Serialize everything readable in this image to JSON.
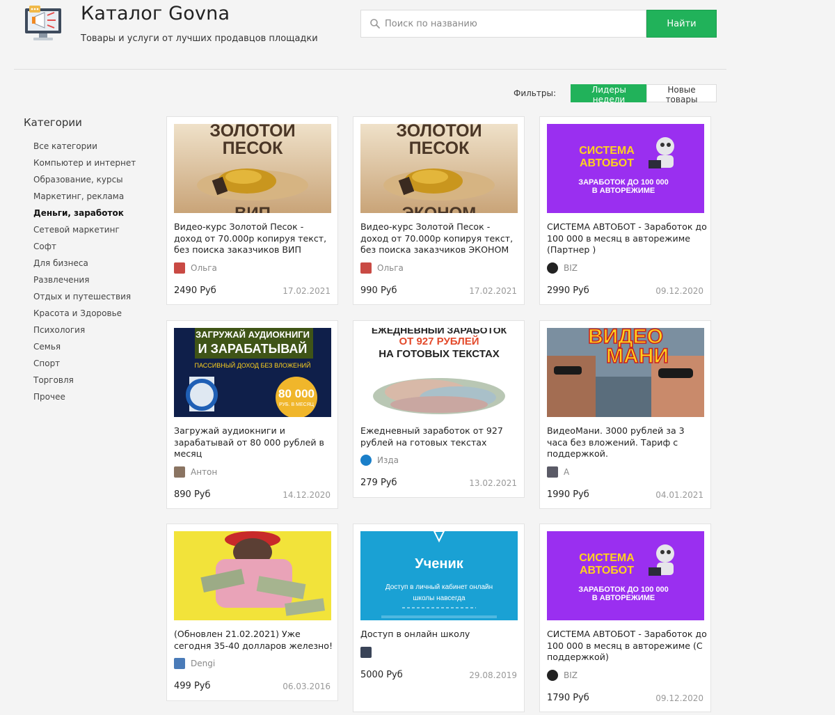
{
  "header": {
    "title": "Каталог Govna",
    "subtitle": "Товары и услуги от лучших продавцов площадки",
    "search_placeholder": "Поиск по названию",
    "search_button": "Найти"
  },
  "filters": {
    "label": "Фильтры:",
    "options": [
      "Лидеры недели",
      "Новые товары"
    ],
    "active": "Лидеры недели"
  },
  "sidebar": {
    "title": "Категории",
    "items": [
      "Все категории",
      "Компьютер и интернет",
      "Образование, курсы",
      "Маркетинг, реклама",
      "Деньги, заработок",
      "Сетевой маркетинг",
      "Софт",
      "Для бизнеса",
      "Развлечения",
      "Отдых и путешествия",
      "Красота и Здоровье",
      "Психология",
      "Семья",
      "Спорт",
      "Торговля",
      "Прочее"
    ],
    "active_index": 4
  },
  "colors": {
    "accent": "#21b25a"
  },
  "products": [
    {
      "image_text": [
        "ЗОЛОТОЙ",
        "ПЕСОК",
        "ВИП"
      ],
      "title": "Видео-курс Золотой Песок - доход от 70.000р копируя текст, без поиска заказчиков ВИП",
      "seller": "Ольга",
      "price": "2490 Руб",
      "date": "17.02.2021"
    },
    {
      "image_text": [
        "ЗОЛОТОЙ",
        "ПЕСОК",
        "ЭКОНОМ"
      ],
      "title": "Видео-курс Золотой Песок - доход от 70.000р копируя текст, без поиска заказчиков ЭКОНОМ",
      "seller": "Ольга",
      "price": "990 Руб",
      "date": "17.02.2021"
    },
    {
      "image_text": [
        "СИСТЕМА",
        "АВТОБОТ",
        "ЗАРАБОТОК ДО 100 000",
        "В АВТОРЕЖИМЕ"
      ],
      "title": "СИСТЕМА АВТОБОТ - Заработок до 100 000 в месяц в авторежиме (Партнер )",
      "seller": "BIZ",
      "price": "2990 Руб",
      "date": "09.12.2020"
    },
    {
      "image_text": [
        "ЗАГРУЖАЙ АУДИОКНИГИ",
        "И ЗАРАБАТЫВАЙ",
        "ПАССИВНЫЙ ДОХОД БЕЗ ВЛОЖЕНИЙ",
        "80 000",
        "РУБ. В МЕСЯЦ"
      ],
      "title": "Загружай аудиокниги и зарабатывай от 80 000 рублей в месяц",
      "seller": "Антон",
      "price": "890 Руб",
      "date": "14.12.2020"
    },
    {
      "image_text": [
        "ЕЖЕДНЕВНЫЙ ЗАРАБОТОК",
        "ОТ 927 РУБЛЕЙ",
        "НА ГОТОВЫХ ТЕКСТАХ"
      ],
      "title": "Ежедневный заработок от 927 рублей на готовых текстах",
      "seller": "Изда",
      "price": "279 Руб",
      "date": "13.02.2021"
    },
    {
      "image_text": [
        "ВИДЕО",
        "МАНИ"
      ],
      "title": "ВидеоМани. 3000 рублей за 3 часа без вложений. Тариф с поддержкой.",
      "seller": "A",
      "price": "1990 Руб",
      "date": "04.01.2021"
    },
    {
      "image_text": [],
      "title": "(Обновлен 21.02.2021) Уже сегодня 35-40 долларов железно!",
      "seller": "Dengi",
      "price": "499 Руб",
      "date": "06.03.2016"
    },
    {
      "image_text": [
        "Ученик",
        "Доступ в личный кабинет онлайн",
        "школы навсегда"
      ],
      "title": "Доступ в онлайн школу",
      "seller": "",
      "price": "5000 Руб",
      "date": "29.08.2019"
    },
    {
      "image_text": [
        "СИСТЕМА",
        "АВТОБОТ",
        "ЗАРАБОТОК ДО 100 000",
        "В АВТОРЕЖИМЕ"
      ],
      "title": "СИСТЕМА АВТОБОТ - Заработок до 100 000 в месяц в авторежиме (С поддержкой)",
      "seller": "BIZ",
      "price": "1790 Руб",
      "date": "09.12.2020"
    }
  ]
}
